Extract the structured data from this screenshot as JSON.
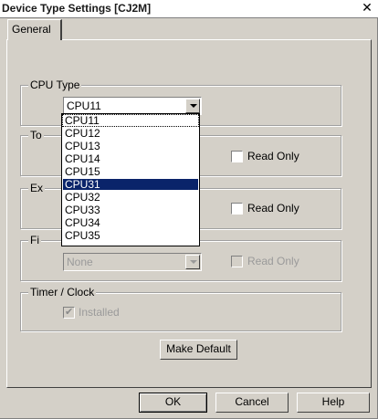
{
  "window": {
    "title": "Device Type Settings [CJ2M]",
    "close_glyph": "✕"
  },
  "tabs": [
    {
      "label": "General"
    }
  ],
  "cpu_type": {
    "legend": "CPU Type",
    "value": "CPU11"
  },
  "dropdown": {
    "options": [
      "CPU11",
      "CPU12",
      "CPU13",
      "CPU14",
      "CPU15",
      "CPU31",
      "CPU32",
      "CPU33",
      "CPU34",
      "CPU35"
    ],
    "highlighted": "CPU31"
  },
  "group2": {
    "legend_visible": "To",
    "read_only_label": "Read Only"
  },
  "group3": {
    "legend_visible": "Ex",
    "read_only_label": "Read Only"
  },
  "group4": {
    "legend_visible": "Fi",
    "combo_value": "None",
    "read_only_label": "Read Only"
  },
  "timer_clock": {
    "legend": "Timer / Clock",
    "installed_label": "Installed",
    "installed_checked": true
  },
  "buttons": {
    "make_default": "Make Default",
    "ok": "OK",
    "cancel": "Cancel",
    "help": "Help"
  },
  "colors": {
    "face": "#d4d0c8",
    "highlight": "#0a246a"
  }
}
